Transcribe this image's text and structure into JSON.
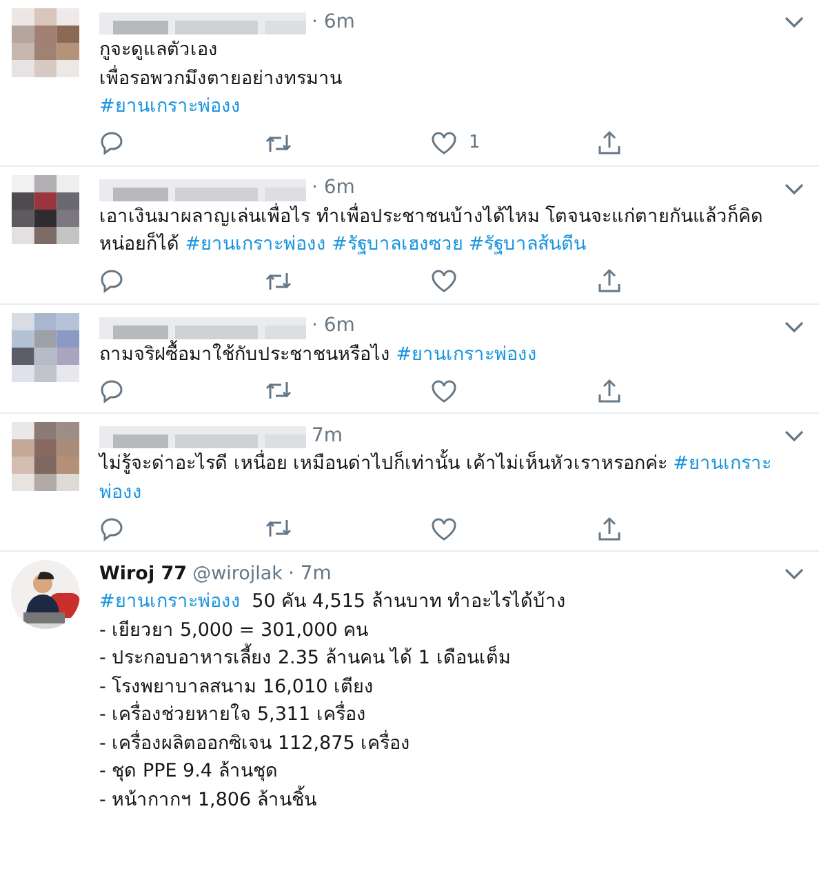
{
  "tweets": [
    {
      "time": "· 6m",
      "lines": [
        [
          {
            "kind": "text",
            "text": "กูจะดูแลตัวเอง"
          }
        ],
        [
          {
            "kind": "text",
            "text": "เพื่อรอพวกมึงตายอย่างทรมาน"
          }
        ],
        [
          {
            "kind": "hashtag",
            "text": "#ยานเกราะพ่องง"
          }
        ]
      ],
      "likes": "1"
    },
    {
      "time": "· 6m",
      "lines": [
        [
          {
            "kind": "text",
            "text": "เอาเงินมาผลาญเล่นเพื่อไร ทำเพื่อประชาชนบ้างได้ไหม โตจนจะแก่ตายกันแล้วก็คิด"
          }
        ],
        [
          {
            "kind": "text",
            "text": "หน่อยก็ได้ "
          },
          {
            "kind": "hashtag",
            "text": "#ยานเกราะพ่องง"
          },
          {
            "kind": "hashtag",
            "text": "#รัฐบาลเฮงซวย"
          },
          {
            "kind": "hashtag",
            "text": "#รัฐบาลส้นตีน"
          }
        ]
      ]
    },
    {
      "time": "· 6m",
      "lines": [
        [
          {
            "kind": "text",
            "text": "ถามจริฝซื้อมาใช้กับประชาชนหรือไง "
          },
          {
            "kind": "hashtag",
            "text": "#ยานเกราะพ่องง"
          }
        ]
      ]
    },
    {
      "time": "7m",
      "lines": [
        [
          {
            "kind": "text",
            "text": "ไม่รู้จะด่าอะไรดี เหนื่อย เหมือนด่าไปก็เท่านั้น เค้าไม่เห็นหัวเราหรอกค่ะ "
          },
          {
            "kind": "hashtag",
            "text": "#ยานเกราะ"
          }
        ],
        [
          {
            "kind": "hashtag",
            "text": "พ่องง"
          }
        ]
      ]
    },
    {
      "author": {
        "name": "Wiroj 77",
        "handle": "@wirojlak"
      },
      "time": "· 7m",
      "lines": [
        [
          {
            "kind": "hashtag",
            "text": "#ยานเกราะพ่องง"
          },
          {
            "kind": "text",
            "text": " 50 คัน 4,515 ล้านบาท ทำอะไรได้บ้าง"
          }
        ],
        [
          {
            "kind": "text",
            "text": "- เยียวยา 5,000 = 301,000 คน"
          }
        ],
        [
          {
            "kind": "text",
            "text": "- ประกอบอาหารเลี้ยง 2.35 ล้านคน ได้ 1 เดือนเต็ม"
          }
        ],
        [
          {
            "kind": "text",
            "text": "- โรงพยาบาลสนาม 16,010 เตียง"
          }
        ],
        [
          {
            "kind": "text",
            "text": "- เครื่องช่วยหายใจ 5,311 เครื่อง"
          }
        ],
        [
          {
            "kind": "text",
            "text": "- เครื่องผลิตออกซิเจน 112,875 เครื่อง"
          }
        ],
        [
          {
            "kind": "text",
            "text": "- ชุด PPE  9.4 ล้านชุด"
          }
        ],
        [
          {
            "kind": "text",
            "text": "- หน้ากากฯ 1,806 ล้านชิ้น"
          }
        ]
      ]
    }
  ]
}
